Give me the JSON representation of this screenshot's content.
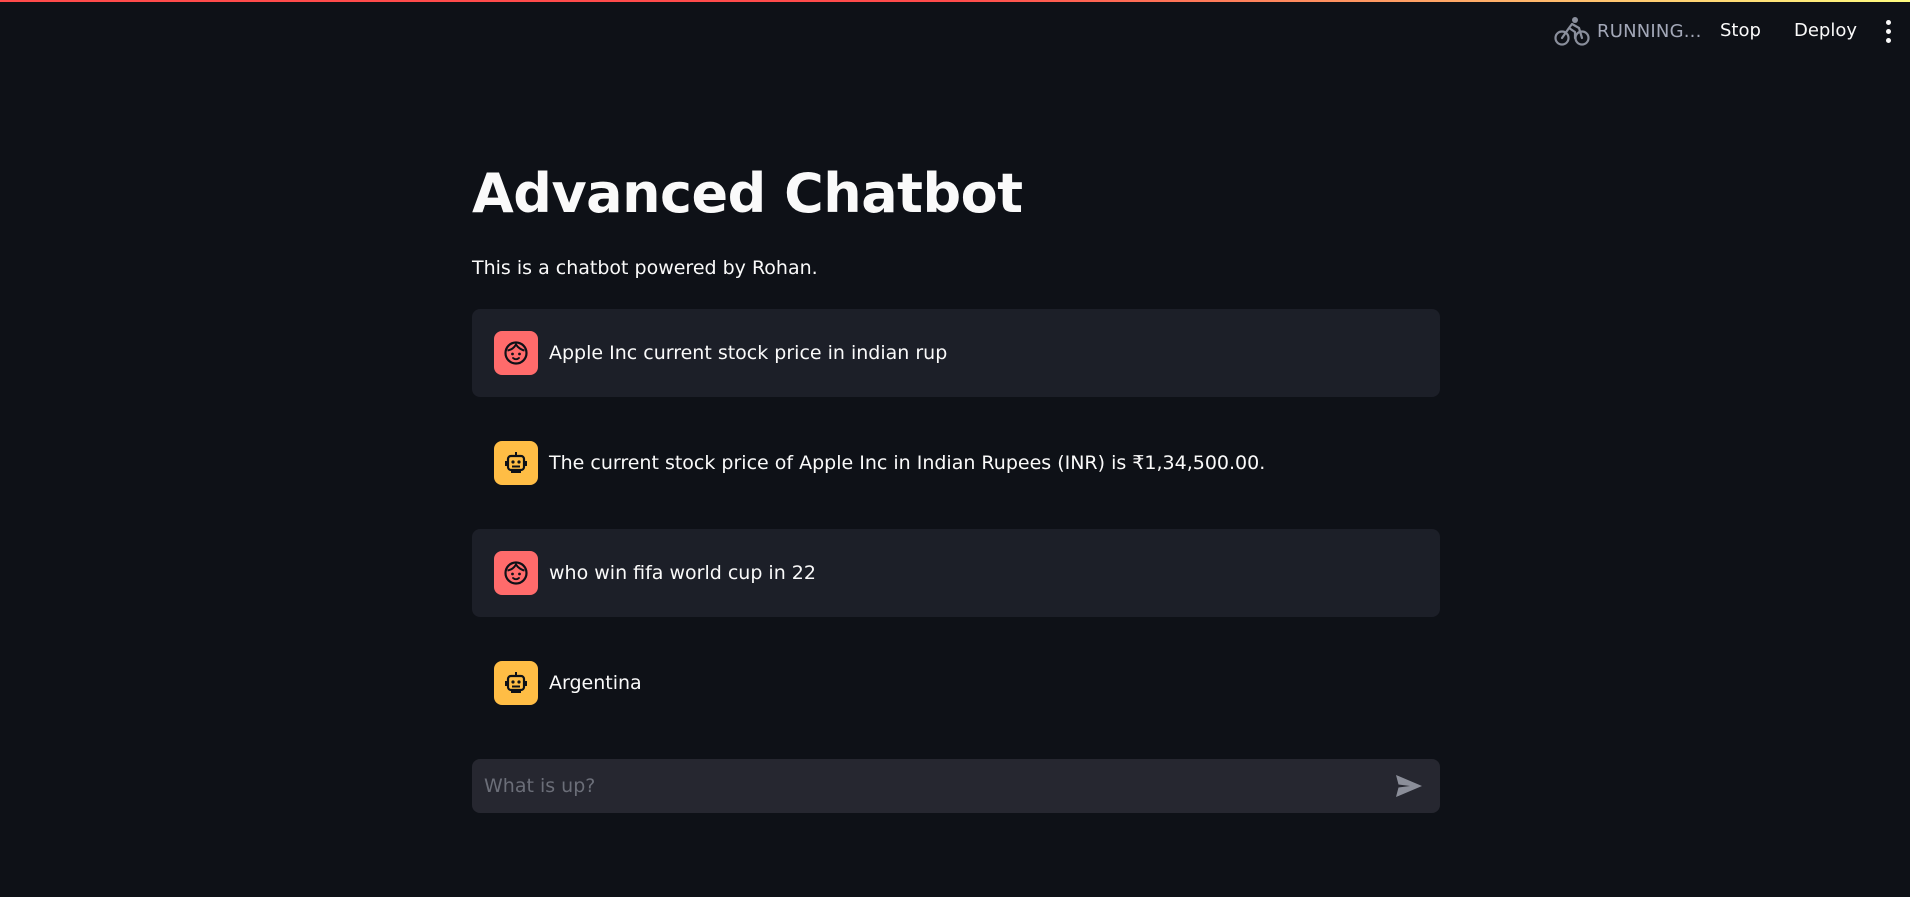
{
  "header": {
    "status_icon": "bicycle-icon",
    "status_text": "RUNNING...",
    "stop_label": "Stop",
    "deploy_label": "Deploy",
    "menu_icon": "vertical-ellipsis-icon"
  },
  "page": {
    "title": "Advanced Chatbot",
    "subtitle": "This is a chatbot powered by Rohan."
  },
  "messages": [
    {
      "role": "user",
      "avatar_icon": "face-icon",
      "text": "Apple Inc current stock price in indian rup"
    },
    {
      "role": "assistant",
      "avatar_icon": "robot-icon",
      "text": "The current stock price of Apple Inc in Indian Rupees (INR) is ₹1,34,500.00."
    },
    {
      "role": "user",
      "avatar_icon": "face-icon",
      "text": "who win fifa world cup in 22"
    },
    {
      "role": "assistant",
      "avatar_icon": "robot-icon",
      "text": "Argentina"
    }
  ],
  "chat_input": {
    "placeholder": "What is up?",
    "value": "",
    "send_icon": "send-icon"
  },
  "colors": {
    "background": "#0e1117",
    "user_message_bg": "#1c1f28",
    "user_avatar": "#ff6b6b",
    "assistant_avatar": "#ffbd45",
    "input_bg": "#262730",
    "accent": "#ff4b4b"
  }
}
